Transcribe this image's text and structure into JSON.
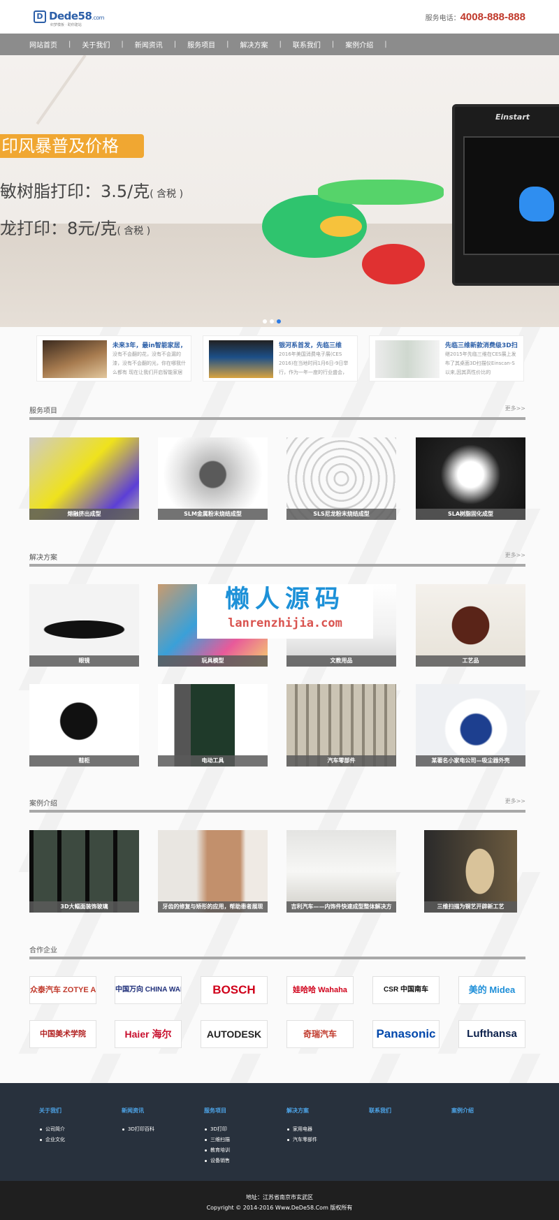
{
  "header": {
    "logo_text": "Dede58",
    "logo_suffix": ".com",
    "logo_sub": "织梦模板 · 助你建站",
    "phone_label": "服务电话：",
    "phone": "4008-888-888"
  },
  "nav": [
    "网站首页",
    "关于我们",
    "新闻资讯",
    "服务项目",
    "解决方案",
    "联系我们",
    "案例介绍"
  ],
  "banner": {
    "tag": "印风暴普及价格",
    "line1": "敏树脂打印：3.5/克",
    "line1_note": "( 含税 )",
    "line2": "龙打印：8元/克",
    "line2_note": "( 含税 )",
    "printer_brand": "Einstart",
    "slides_active": 3
  },
  "news": [
    {
      "title": "未来3年，最in智能家居，",
      "desc": "没有不会翻的花，没有不会漏的漆，没有不会翻的光，你在哪我什么都有 现在让我们开启智能家居"
    },
    {
      "title": "银河系首发，先临三维",
      "desc": "2016年美国消费电子展(CES 2016)在当地时间1月6日-9日举行，作为一年一度的行业盛会，"
    },
    {
      "title": "先临三维新款消费级3D扫",
      "desc": "继2015年先临三维在CES展上发布了其桌面3D扫描仪Einscan-S以来,因其高性价比的"
    }
  ],
  "services": {
    "title": "服务项目",
    "more": "更多>>",
    "items": [
      "熔融挤出成型",
      "SLM金属粉末烧结成型",
      "SLS尼龙粉末烧结成型",
      "SLA树脂固化成型"
    ]
  },
  "solutions": {
    "title": "解决方案",
    "more": "更多>>",
    "items": [
      "眼镜",
      "玩具模型",
      "文教用品",
      "工艺品",
      "鞋柜",
      "电动工具",
      "汽车零部件",
      "某著名小家电公司—吸尘器外壳"
    ]
  },
  "cases": {
    "title": "案例介绍",
    "more": "更多>>",
    "items": [
      "3D大幅面装饰玻璃",
      "牙齿的修复与矫形的应用，帮助患者展现",
      "吉利汽车——内饰件快速成型整体解决方",
      "三维扫描为铜艺开辟新工艺"
    ]
  },
  "partners": {
    "title": "合作企业",
    "items": [
      "众泰汽车 ZOTYE AUTO",
      "中国万向 CHINA WANXIANG",
      "BOSCH",
      "娃哈哈 Wahaha",
      "CSR 中国南车",
      "美的 Midea",
      "中国美术学院",
      "Haier 海尔",
      "AUTODESK",
      "奇瑞汽车",
      "Panasonic",
      "Lufthansa"
    ]
  },
  "footer": {
    "columns": [
      {
        "title": "关于我们",
        "links": [
          "公司简介",
          "企业文化"
        ]
      },
      {
        "title": "新闻资讯",
        "links": [
          "3D打印百科"
        ]
      },
      {
        "title": "服务项目",
        "links": [
          "3D打印",
          "三维扫描",
          "教育培训",
          "设备销售"
        ]
      },
      {
        "title": "解决方案",
        "links": [
          "家用电器",
          "汽车零部件"
        ]
      },
      {
        "title": "联系我们",
        "links": []
      },
      {
        "title": "案例介绍",
        "links": []
      }
    ],
    "address": "地址：江苏省南京市玄武区",
    "copyright": "Copyright © 2014-2016 Www.DeDe58.Com 版权所有"
  },
  "watermark": {
    "cn": "懒人源码",
    "url": "lanrenzhijia.com"
  },
  "colors": {
    "accent": "#2c5fa8",
    "phone": "#c0392b",
    "nav_bg": "#8c8c8c",
    "banner_tag": "#f0a732",
    "footer_bg": "#28313d",
    "footer_title": "#4da3e6"
  }
}
